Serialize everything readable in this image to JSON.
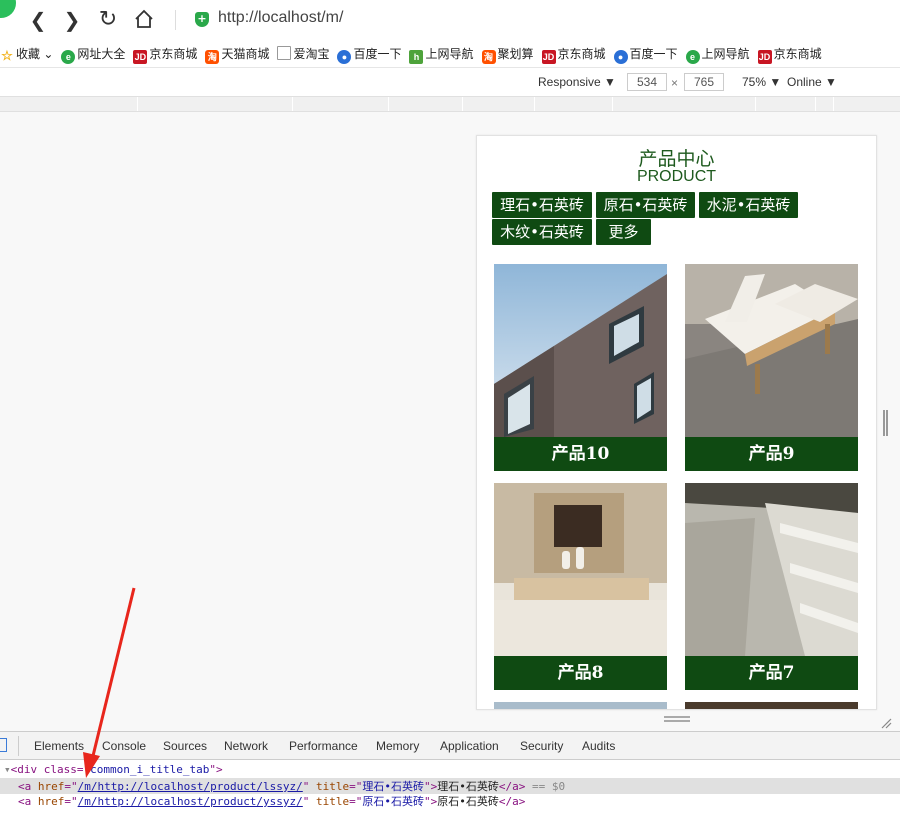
{
  "browser": {
    "url": "http://localhost/m/",
    "bookmarks": [
      {
        "label": "收藏",
        "icon": "star-icon"
      },
      {
        "label": "网址大全",
        "icon": "globe-icon"
      },
      {
        "label": "京东商城",
        "icon": "jd-icon"
      },
      {
        "label": "天猫商城",
        "icon": "tao-icon"
      },
      {
        "label": "爱淘宝",
        "icon": "page-icon"
      },
      {
        "label": "百度一下",
        "icon": "paw-icon"
      },
      {
        "label": "上网导航",
        "icon": "hao-icon"
      },
      {
        "label": "聚划算",
        "icon": "tao-icon"
      },
      {
        "label": "京东商城",
        "icon": "jd-icon"
      },
      {
        "label": "百度一下",
        "icon": "paw-icon"
      },
      {
        "label": "上网导航",
        "icon": "globe-icon"
      },
      {
        "label": "京东商城",
        "icon": "jd-icon"
      }
    ]
  },
  "device_toolbar": {
    "mode": "Responsive",
    "width": "534",
    "times": "×",
    "height": "765",
    "zoom": "75%",
    "network": "Online"
  },
  "page": {
    "title_cn": "产品中心",
    "title_en": "PRODUCT",
    "tabs": [
      "理石•石英砖",
      "原石•石英砖",
      "水泥•石英砖",
      "木纹•石英砖",
      "更多"
    ],
    "products": [
      "产品10",
      "产品9",
      "产品8",
      "产品7"
    ]
  },
  "devtools": {
    "tabs": [
      "Elements",
      "Console",
      "Sources",
      "Network",
      "Performance",
      "Memory",
      "Application",
      "Security",
      "Audits"
    ],
    "line1_tag": "<div class=\"",
    "line1_class": "common_i_title_tab",
    "line1_end": "\">",
    "line2_href": "/m/http://localhost/product/lssyz/",
    "line2_title": "理石•石英砖",
    "line2_text": "理石•石英砖",
    "line2_sel": "== $0",
    "line3_href": "/m/http://localhost/product/yssyz/",
    "line3_title": "原石•石英砖",
    "line3_text": "原石•石英砖"
  },
  "colors": {
    "accent_green": "#0f4a12",
    "title_green": "#1e5a1e",
    "arrow_red": "#e8261c"
  }
}
